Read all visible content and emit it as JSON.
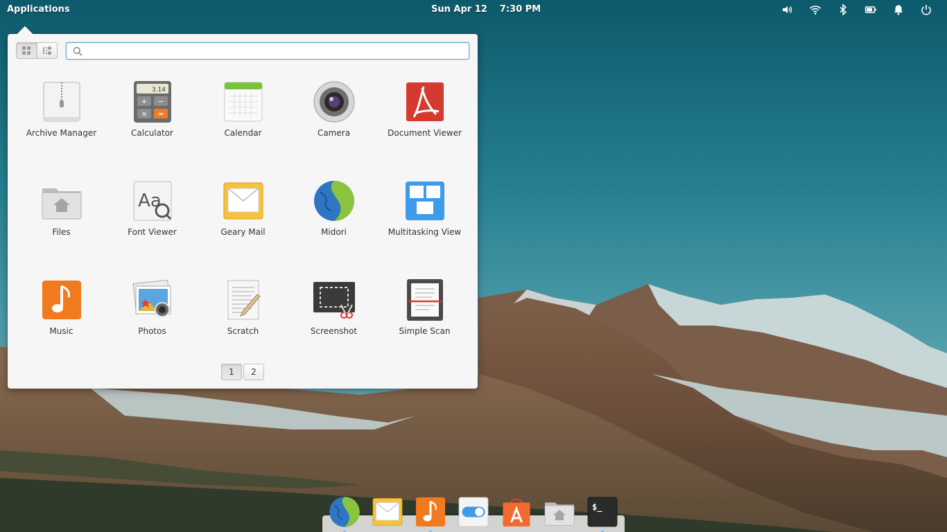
{
  "panel": {
    "applications_label": "Applications",
    "date": "Sun Apr 12",
    "time": "7:30 PM",
    "indicators": [
      "volume-icon",
      "wifi-icon",
      "bluetooth-icon",
      "battery-icon",
      "notifications-icon",
      "power-icon"
    ]
  },
  "menu": {
    "view_modes": [
      "grid-view-icon",
      "category-view-icon"
    ],
    "active_view": "grid",
    "search": {
      "value": "",
      "placeholder": ""
    },
    "apps": [
      {
        "label": "Archive Manager",
        "icon": "archive-manager-icon"
      },
      {
        "label": "Calculator",
        "icon": "calculator-icon",
        "display": "3.14"
      },
      {
        "label": "Calendar",
        "icon": "calendar-icon"
      },
      {
        "label": "Camera",
        "icon": "camera-icon"
      },
      {
        "label": "Document Viewer",
        "icon": "document-viewer-icon"
      },
      {
        "label": "Files",
        "icon": "files-icon"
      },
      {
        "label": "Font Viewer",
        "icon": "font-viewer-icon",
        "glyph": "Aa"
      },
      {
        "label": "Geary Mail",
        "icon": "geary-mail-icon"
      },
      {
        "label": "Midori",
        "icon": "midori-icon"
      },
      {
        "label": "Multitasking View",
        "icon": "multitasking-view-icon"
      },
      {
        "label": "Music",
        "icon": "music-icon"
      },
      {
        "label": "Photos",
        "icon": "photos-icon"
      },
      {
        "label": "Scratch",
        "icon": "scratch-icon"
      },
      {
        "label": "Screenshot",
        "icon": "screenshot-icon"
      },
      {
        "label": "Simple Scan",
        "icon": "simple-scan-icon"
      }
    ],
    "pages": [
      "1",
      "2"
    ],
    "current_page": "1"
  },
  "dock": {
    "items": [
      {
        "icon": "midori-icon",
        "running": true
      },
      {
        "icon": "geary-mail-icon",
        "running": false
      },
      {
        "icon": "music-icon",
        "running": true
      },
      {
        "icon": "system-settings-icon",
        "running": false
      },
      {
        "icon": "appcenter-icon",
        "running": false
      },
      {
        "icon": "files-icon",
        "running": false
      },
      {
        "icon": "terminal-icon",
        "running": true
      }
    ],
    "terminal_glyph": "$_"
  },
  "colors": {
    "accent": "#4f9ad6",
    "dock_indicator": "#5fb6ff",
    "panel_text": "#ffffff"
  }
}
